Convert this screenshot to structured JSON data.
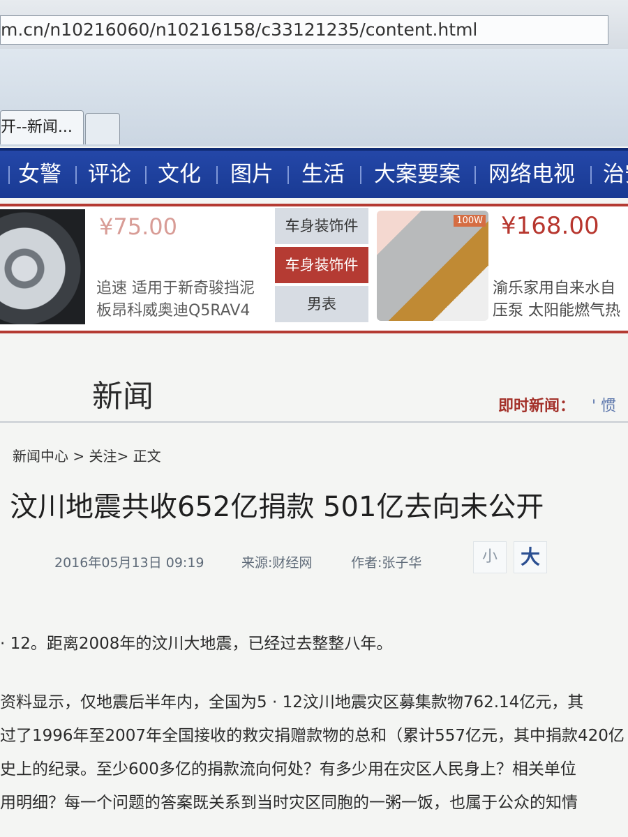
{
  "browser": {
    "url": "m.cn/n10216060/n10216158/c33121235/content.html",
    "tab_label": "开--新闻..."
  },
  "nav": {
    "items": [
      "女警",
      "评论",
      "文化",
      "图片",
      "生活",
      "大案要案",
      "网络电视",
      "治安"
    ]
  },
  "ad": {
    "left": {
      "price": "¥75.00",
      "desc_line1": "追速 适用于新奇骏挡泥",
      "desc_line2": "板昂科威奥迪Q5RAV4"
    },
    "menu": [
      "车身装饰件",
      "车身装饰件",
      "男表"
    ],
    "right": {
      "price": "¥168.00",
      "desc_line1": "渝乐家用自来水自",
      "desc_line2": "压泵 太阳能燃气热"
    },
    "badge": "100W",
    "colors": {
      "accent": "#b43a32",
      "menu_selected_bg": "#b53b33",
      "menu_bg": "#d7dce3"
    }
  },
  "section": {
    "title": "新闻",
    "instant_label": "即时新闻：",
    "instant_ticker": "' 惯"
  },
  "article": {
    "breadcrumb": "新闻中心  >  关注>  正文",
    "headline": "汶川地震共收652亿捐款  501亿去向未公开",
    "date": "2016年05月13日  09:19",
    "source": "来源:财经网",
    "author": "作者:张子华",
    "font_small": "小",
    "font_large": "大",
    "paragraphs": [
      "· 12。距离2008年的汶川大地震，已经过去整整八年。",
      "资料显示，仅地震后半年内，全国为5 · 12汶川地震灾区募集款物762.14亿元，其",
      "过了1996年至2007年全国接收的救灾捐赠款物的总和（累计557亿元，其中捐款420亿",
      "史上的纪录。至少600多亿的捐款流向何处？有多少用在灾区人民身上？相关单位",
      "用明细？每一个问题的答案既关系到当时灾区同胞的一粥一饭，也属于公众的知情"
    ]
  },
  "icons": {
    "new_tab": "new-tab-icon"
  }
}
